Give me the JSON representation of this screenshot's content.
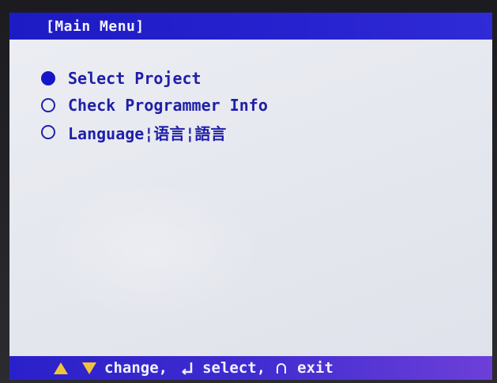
{
  "title": "[Main Menu]",
  "menu": {
    "items": [
      {
        "label": "Select Project",
        "selected": true
      },
      {
        "label": "Check Programmer Info",
        "selected": false
      },
      {
        "label": "Language¦语言¦語言",
        "selected": false
      }
    ]
  },
  "statusbar": {
    "change_label": "change,",
    "select_label": "select,",
    "exit_label": "exit"
  },
  "icons": {
    "up": "triangle-up-icon",
    "down": "triangle-down-icon",
    "enter": "enter-key-icon",
    "exit": "exit-key-icon"
  },
  "colors": {
    "titlebar": "#1d1bc4",
    "screen_bg": "#e6e8ef",
    "text": "#1f1fa8",
    "arrow": "#f0c43a"
  }
}
